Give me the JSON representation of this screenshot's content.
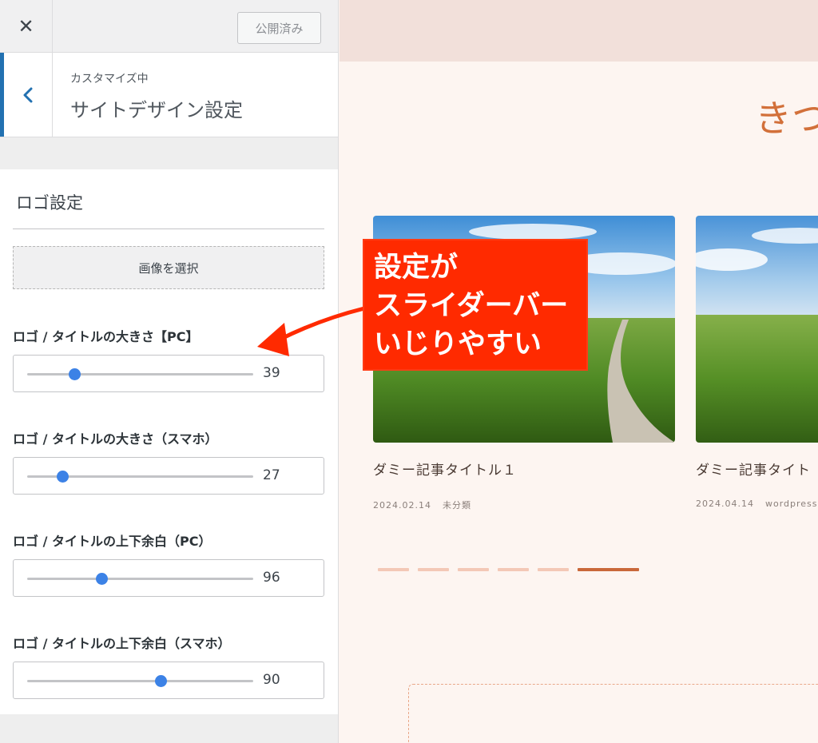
{
  "topbar": {
    "close_icon": "✕",
    "publish_label": "公開済み"
  },
  "section_header": {
    "customizing": "カスタマイズ中",
    "title": "サイトデザイン設定",
    "back_icon": "‹"
  },
  "logo_settings": {
    "heading": "ロゴ設定",
    "select_image": "画像を選択",
    "sliders": [
      {
        "label": "ロゴ / タイトルの大きさ【PC】",
        "value": "39",
        "fraction": 0.21
      },
      {
        "label": "ロゴ / タイトルの大きさ（スマホ）",
        "value": "27",
        "fraction": 0.155
      },
      {
        "label": "ロゴ / タイトルの上下余白（PC）",
        "value": "96",
        "fraction": 0.33
      },
      {
        "label": "ロゴ / タイトルの上下余白（スマホ）",
        "value": "90",
        "fraction": 0.59
      }
    ]
  },
  "preview": {
    "site_title": "きつ",
    "cards": [
      {
        "title": "ダミー記事タイトル１",
        "date": "2024.02.14",
        "category": "未分類"
      },
      {
        "title": "ダミー記事タイト",
        "date": "2024.04.14",
        "category": "wordpress"
      }
    ],
    "pager_count": 6,
    "pager_active": 5
  },
  "callout": {
    "lines": [
      "設定が",
      "スライダーバー",
      "いじりやすい"
    ]
  },
  "colors": {
    "accent_blue": "#2271b1",
    "slider_blue": "#3c82e6",
    "site_orange": "#d2703a",
    "callout_red": "#ff2a00"
  }
}
